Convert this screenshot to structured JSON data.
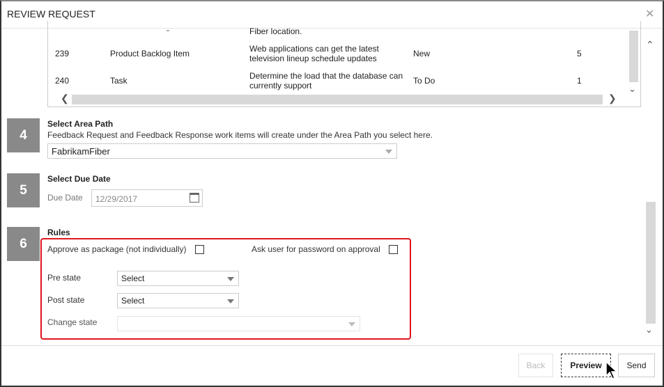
{
  "dialog": {
    "title": "REVIEW REQUEST",
    "close_icon": "close-icon"
  },
  "table": {
    "partial_row": {
      "desc": "Fiber location."
    },
    "rows": [
      {
        "id": "239",
        "type": "Product Backlog Item",
        "desc1": "Web applications can get the latest",
        "desc2": "television lineup schedule updates",
        "state": "New",
        "value": "5"
      },
      {
        "id": "240",
        "type": "Task",
        "desc1": "Determine the load that the database can",
        "desc2": "currently support",
        "state": "To Do",
        "value": "1"
      }
    ]
  },
  "step4": {
    "number": "4",
    "title": "Select Area Path",
    "desc": "Feedback Request and Feedback Response work items will create under the Area Path you select here.",
    "value": "FabrikamFiber"
  },
  "step5": {
    "number": "5",
    "title": "Select Due Date",
    "label": "Due Date",
    "value": "12/29/2017"
  },
  "step6": {
    "number": "6",
    "title": "Rules",
    "approve_package": "Approve as package (not individually)",
    "ask_password": "Ask user for password on approval",
    "pre_state_label": "Pre state",
    "pre_state_value": "Select",
    "post_state_label": "Post state",
    "post_state_value": "Select",
    "change_state_label": "Change state",
    "change_state_value": "",
    "highlight_color": "#e0141e"
  },
  "footer": {
    "back": "Back",
    "preview": "Preview",
    "send": "Send"
  }
}
